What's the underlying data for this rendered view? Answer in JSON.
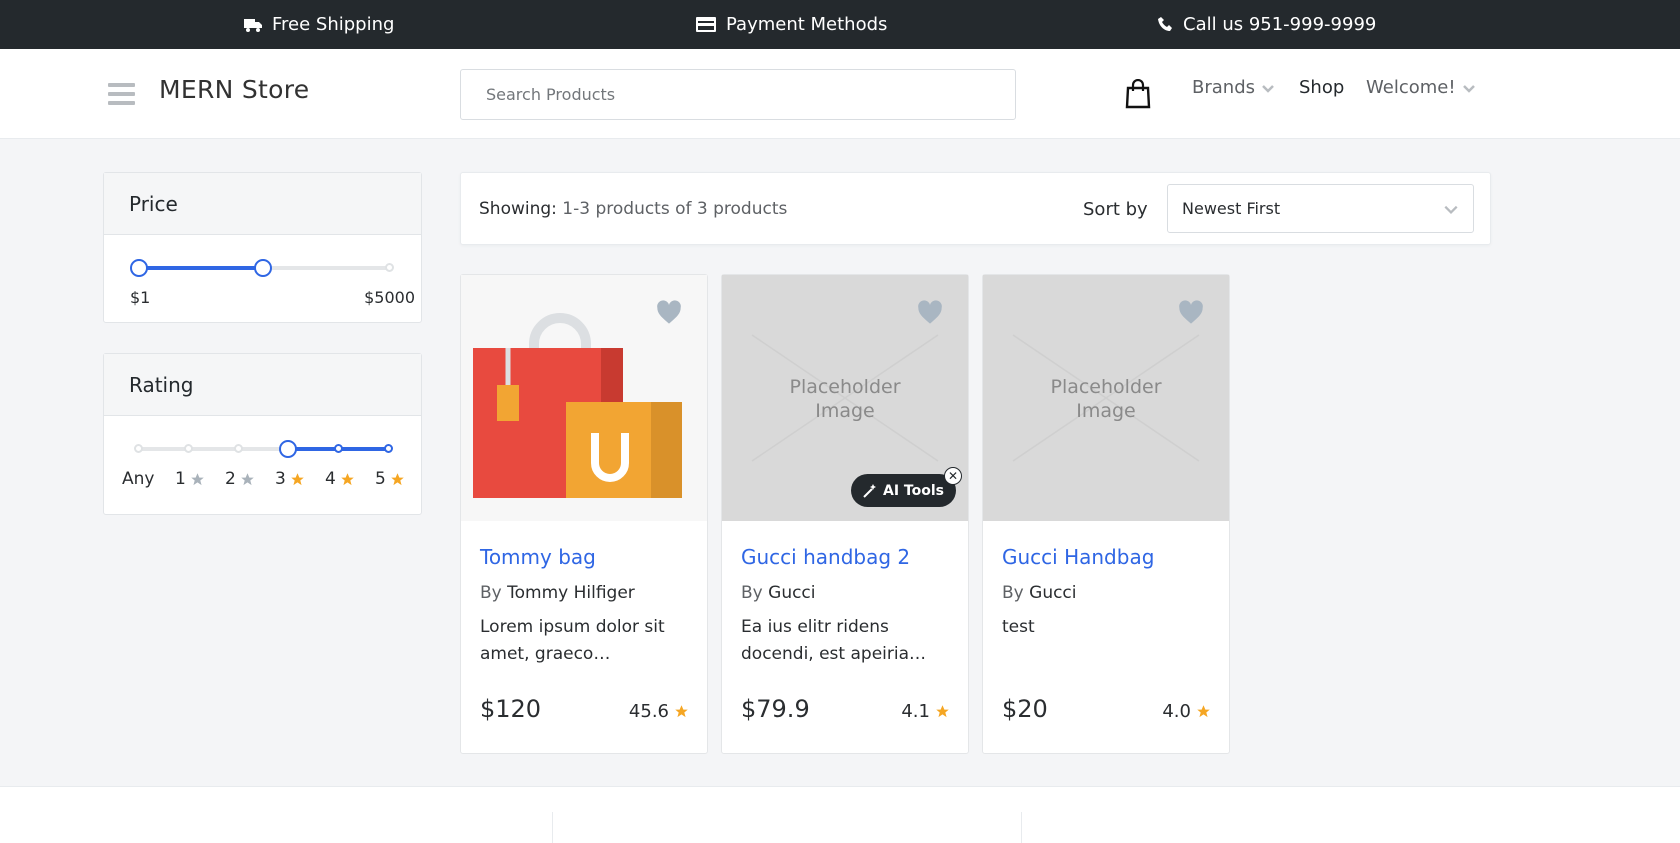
{
  "topbar": {
    "shipping": "Free Shipping",
    "payment": "Payment Methods",
    "call": "Call us 951-999-9999"
  },
  "header": {
    "logo": "MERN Store",
    "search_placeholder": "Search Products",
    "nav": {
      "brands": "Brands",
      "shop": "Shop",
      "welcome": "Welcome!"
    }
  },
  "filters": {
    "price": {
      "title": "Price",
      "min_label": "$1",
      "max_label": "$5000",
      "selected_fraction": [
        0,
        0.5
      ]
    },
    "rating": {
      "title": "Rating",
      "options": [
        "Any",
        "1",
        "2",
        "3",
        "4",
        "5"
      ],
      "selected_index": 3
    }
  },
  "listing": {
    "showing_label": "Showing:",
    "showing_value": "1-3 products of 3 products",
    "sort_label": "Sort by",
    "sort_value": "Newest First"
  },
  "products": [
    {
      "name": "Tommy bag",
      "by": "By",
      "brand": "Tommy Hilfiger",
      "description": "Lorem ipsum dolor sit amet, graeco…",
      "price": "$120",
      "rating": "45.6",
      "image": "shopping-bags"
    },
    {
      "name": "Gucci handbag 2",
      "by": "By",
      "brand": "Gucci",
      "description": "Ea ius elitr ridens docendi, est apeiria…",
      "price": "$79.9",
      "rating": "4.1",
      "image": "placeholder"
    },
    {
      "name": "Gucci Handbag",
      "by": "By",
      "brand": "Gucci",
      "description": "test",
      "price": "$20",
      "rating": "4.0",
      "image": "placeholder"
    }
  ],
  "placeholder_text_1": "Placeholder",
  "placeholder_text_2": "Image",
  "ai_tools_label": "AI Tools",
  "colors": {
    "accent": "#2f66e4",
    "topbar": "#24292d",
    "star": "#f5a623",
    "heart": "#a9b6c2"
  }
}
